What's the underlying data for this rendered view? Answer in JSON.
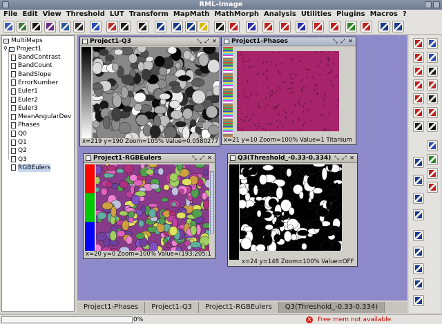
{
  "window": {
    "title": "RML-Image"
  },
  "menu": [
    "File",
    "Edit",
    "View",
    "Threshold",
    "LUT",
    "Transform",
    "MapMath",
    "MathMorph",
    "Analysis",
    "Utilities",
    "Plugins",
    "Macros",
    "?"
  ],
  "tree": {
    "root": "MultiMaps",
    "project": "Project1",
    "items": [
      "BandContrast",
      "BandCount",
      "BandSlope",
      "ErrorNumber",
      "Euler1",
      "Euler2",
      "Euler3",
      "MeanAngularDev",
      "Phases",
      "Q0",
      "Q1",
      "Q2",
      "Q3",
      "RGBEulers"
    ],
    "selected": "RGBEulers"
  },
  "frames": {
    "q3": {
      "title": "Project1-Q3",
      "status": "x=219  y=190  Zoom=105%  Value=0.0580277"
    },
    "phases": {
      "title": "Project1-Phases",
      "status": "x=21  y=10  Zoom=100%  Value=1  Titanium"
    },
    "rgb": {
      "title": "Project1-RGBEulers",
      "status": "x=20  y=0  Zoom=100%  Value=(193;205;1"
    },
    "thresh": {
      "title": "Q3(Threshold_-0.33-0.334)",
      "status": "x=24  y=148  Zoom=100%  Value=OFF"
    }
  },
  "tabs": [
    "Project1-Phases",
    "Project1-Q3",
    "Project1-RGBEulers",
    "Q3(Threshold_-0.33-0.334)"
  ],
  "active_tab": "Q3(Threshold_-0.33-0.334)",
  "status": {
    "progress_text": "0%",
    "memory_message": "Free mem not available."
  },
  "colors": {
    "desktop": "#8e8ac9",
    "phases_fill": "#a8246a",
    "accent_blue": "#2244cc"
  }
}
